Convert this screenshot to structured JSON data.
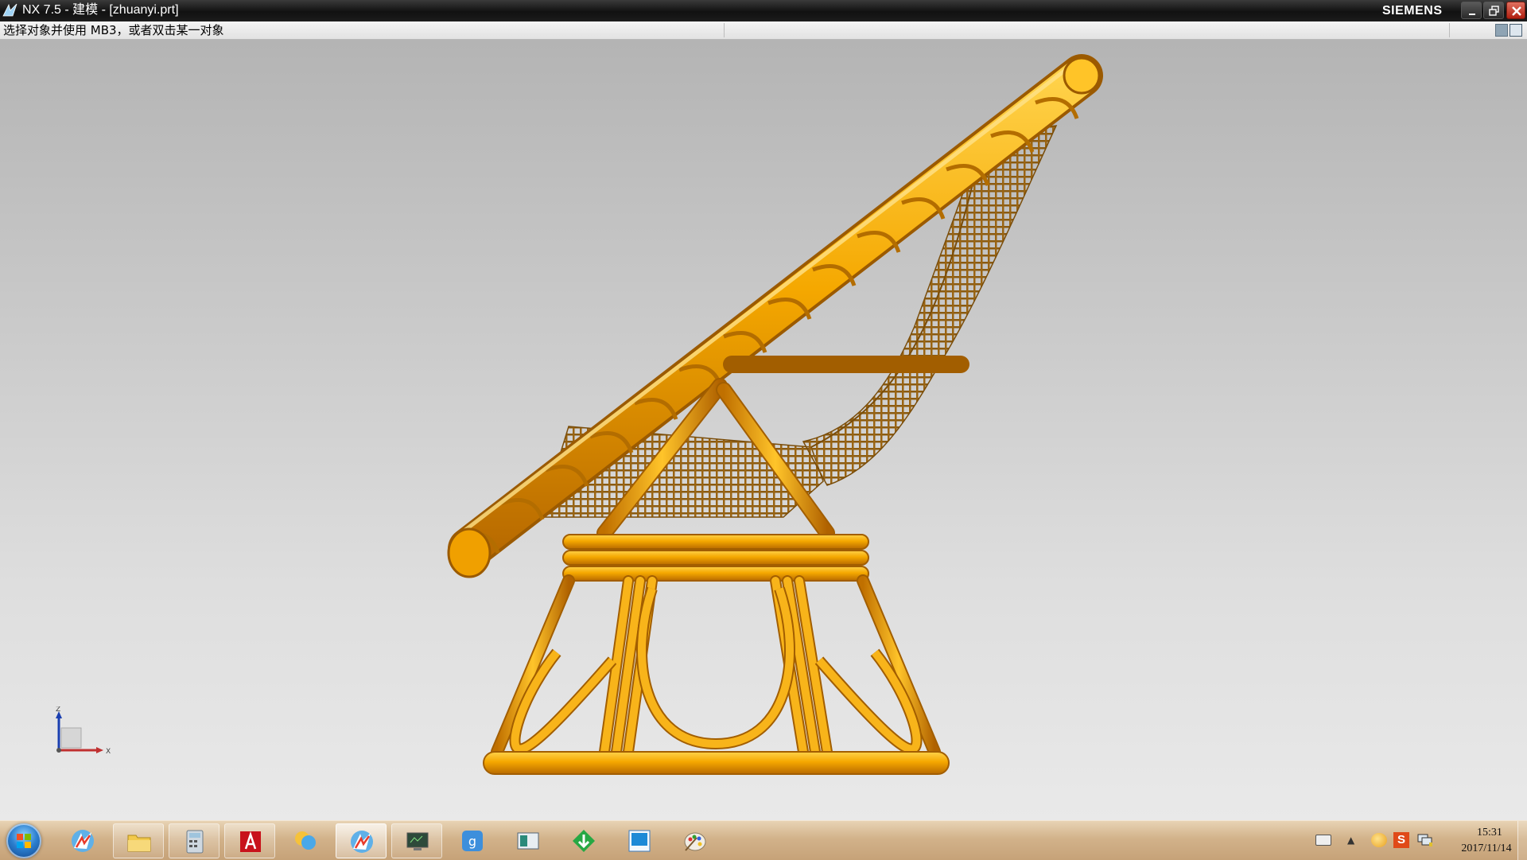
{
  "window": {
    "title": "NX 7.5 - 建模 - [zhuanyi.prt]",
    "brand": "SIEMENS",
    "buttons": [
      "minimize",
      "restore",
      "close"
    ]
  },
  "cue_line": {
    "text": "选择对象并使用 MB3，或者双击某一对象"
  },
  "graphics": {
    "model_color": "#f5a800",
    "background_top": "#b4b4b4",
    "background_bottom": "#e9e9e9",
    "triad": {
      "z_label": "Z",
      "x_label": "X"
    }
  },
  "taskbar": {
    "items": [
      {
        "name": "start",
        "icon": "windows-start-icon"
      },
      {
        "name": "nx-7.5",
        "icon": "nx-app-icon"
      },
      {
        "name": "explorer",
        "icon": "folder-icon"
      },
      {
        "name": "calculator",
        "icon": "calculator-icon"
      },
      {
        "name": "autocad-mechanical",
        "icon": "autocad-icon"
      },
      {
        "name": "messenger",
        "icon": "chat-icon"
      },
      {
        "name": "nx-running",
        "icon": "nx-app-icon",
        "active": true
      },
      {
        "name": "terminal",
        "icon": "monitor-icon"
      },
      {
        "name": "qq-input",
        "icon": "input-method-icon"
      },
      {
        "name": "window-app",
        "icon": "window-icon"
      },
      {
        "name": "download-app",
        "icon": "download-icon"
      },
      {
        "name": "media-app",
        "icon": "blue-window-icon"
      },
      {
        "name": "paint",
        "icon": "paint-palette-icon"
      }
    ],
    "clock": {
      "time": "15:31",
      "date": "2017/11/14"
    }
  }
}
